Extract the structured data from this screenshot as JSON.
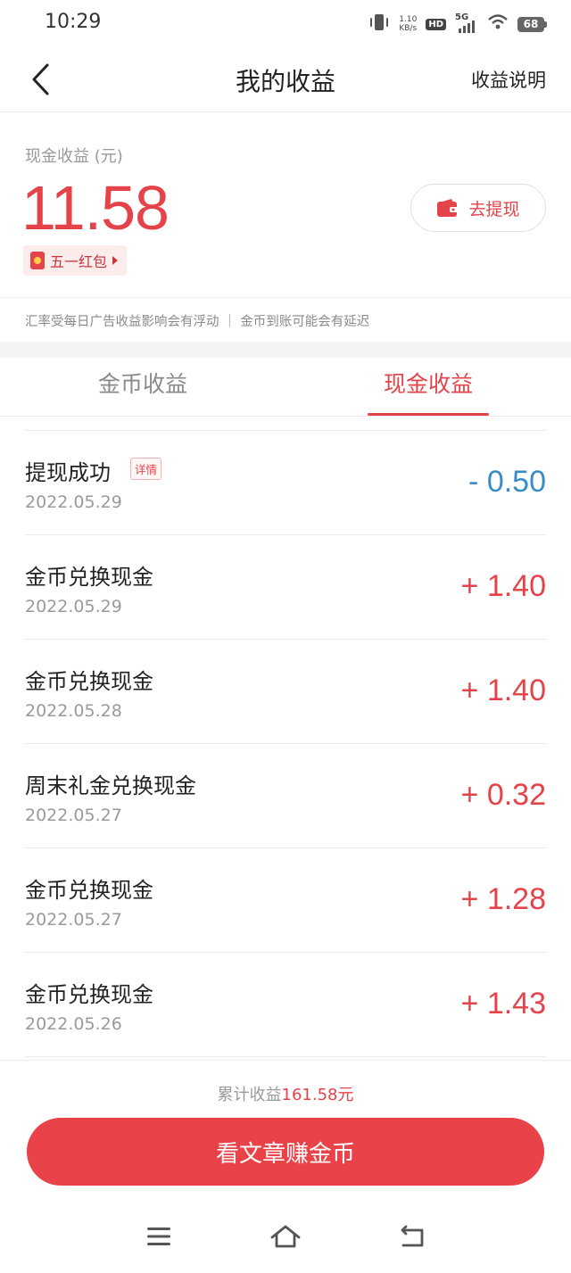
{
  "status_bar": {
    "time": "10:29",
    "speed_value": "1.10",
    "speed_unit": "KB/s",
    "hd": "HD",
    "network": "5G",
    "battery": "68"
  },
  "header": {
    "title": "我的收益",
    "help_label": "收益说明"
  },
  "summary": {
    "cash_label": "现金收益 (元)",
    "cash_amount": "11.58",
    "hongbao_label": "五一红包",
    "withdraw_label": "去提现",
    "notice": "汇率受每日广告收益影响会有浮动 ｜ 金币到账可能会有延迟"
  },
  "tabs": [
    {
      "label": "金币收益",
      "active": false
    },
    {
      "label": "现金收益",
      "active": true
    }
  ],
  "records": [
    {
      "title": "提现成功",
      "tag": "详情",
      "date": "2022.05.29",
      "amount": "- 0.50"
    },
    {
      "title": "金币兑换现金",
      "date": "2022.05.29",
      "amount": "+ 1.40"
    },
    {
      "title": "金币兑换现金",
      "date": "2022.05.28",
      "amount": "+ 1.40"
    },
    {
      "title": "周末礼金兑换现金",
      "date": "2022.05.27",
      "amount": "+ 0.32"
    },
    {
      "title": "金币兑换现金",
      "date": "2022.05.27",
      "amount": "+ 1.28"
    },
    {
      "title": "金币兑换现金",
      "date": "2022.05.26",
      "amount": "+ 1.43"
    }
  ],
  "footer": {
    "total_label": "累计收益",
    "total_value": "161.58元",
    "cta_label": "看文章赚金币"
  },
  "colors": {
    "accent": "#e5434a",
    "minus": "#3a8cc6"
  }
}
